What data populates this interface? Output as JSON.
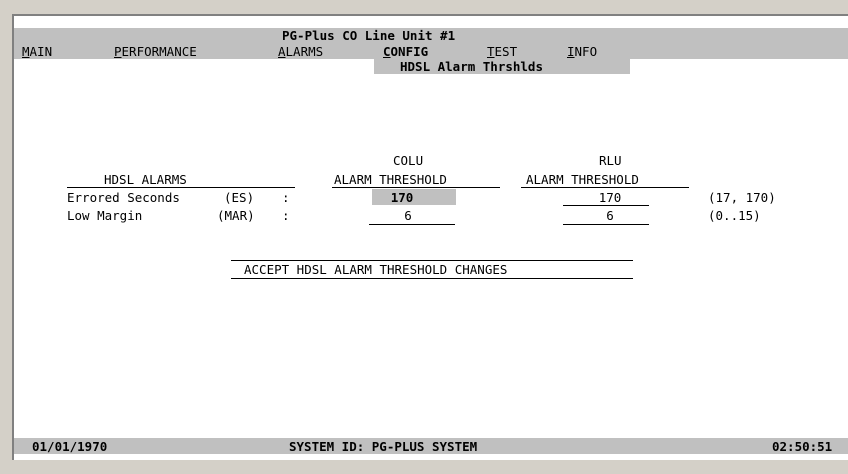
{
  "app": {
    "title": "PG-Plus CO Line Unit #1"
  },
  "menu": [
    {
      "hot": "M",
      "rest": "AIN"
    },
    {
      "hot": "P",
      "rest": "ERFORMANCE"
    },
    {
      "hot": "A",
      "rest": "LARMS"
    },
    {
      "hot": "C",
      "rest": "ONFIG"
    },
    {
      "hot": "T",
      "rest": "EST"
    },
    {
      "hot": "I",
      "rest": "NFO"
    }
  ],
  "submenu": {
    "selected": "HDSL Alarm Thrshlds"
  },
  "table": {
    "section_header": "HDSL ALARMS",
    "colu_header_1": "COLU",
    "colu_header_2": "ALARM THRESHOLD",
    "rlu_header_1": "RLU",
    "rlu_header_2": "ALARM THRESHOLD",
    "rows": [
      {
        "label": "Errored Seconds",
        "abbr": "(ES)",
        "sep": ":",
        "colu": "170",
        "rlu": "170",
        "range": "(17, 170)"
      },
      {
        "label": "Low Margin",
        "abbr": "(MAR)",
        "sep": ":",
        "colu": "6",
        "rlu": "6",
        "range": "(0..15)"
      }
    ]
  },
  "accept_button": "ACCEPT HDSL ALARM THRESHOLD CHANGES",
  "status": {
    "date": "01/01/1970",
    "system_id": "SYSTEM ID: PG-PLUS SYSTEM",
    "time": "02:50:51"
  }
}
